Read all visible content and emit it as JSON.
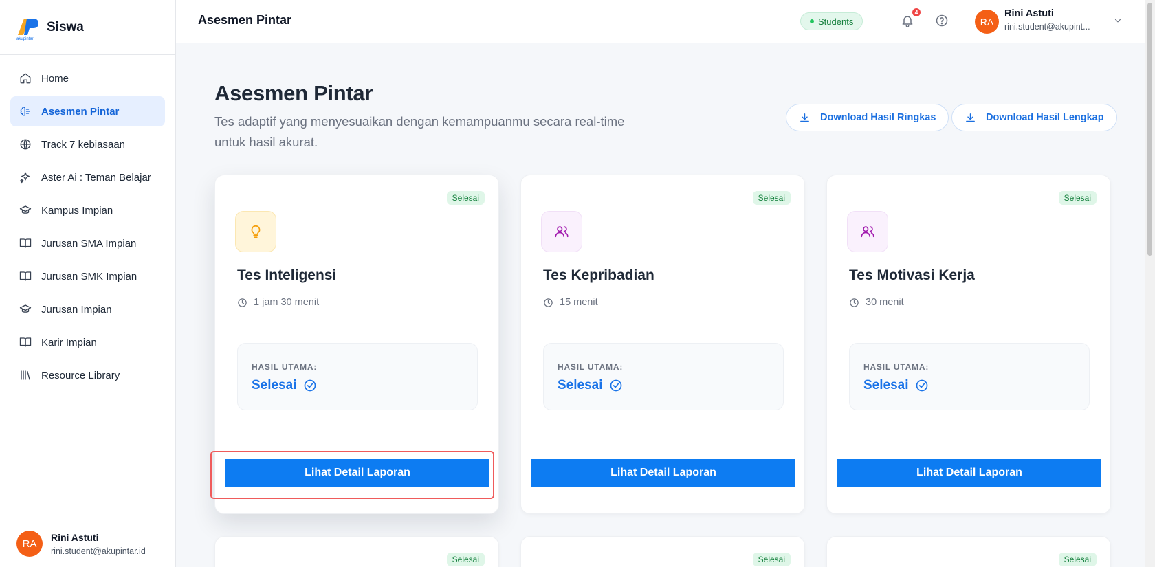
{
  "sidebar": {
    "brand": "Siswa",
    "logo_text": "akupintar",
    "items": [
      {
        "label": "Home",
        "icon": "home-icon"
      },
      {
        "label": "Asesmen Pintar",
        "icon": "brain-icon",
        "active": true
      },
      {
        "label": "Track 7 kebiasaan",
        "icon": "globe-icon"
      },
      {
        "label": "Aster Ai : Teman Belajar",
        "icon": "sparkles-icon"
      },
      {
        "label": "Kampus Impian",
        "icon": "graduation-cap-icon"
      },
      {
        "label": "Jurusan SMA Impian",
        "icon": "book-icon"
      },
      {
        "label": "Jurusan SMK Impian",
        "icon": "book-icon"
      },
      {
        "label": "Jurusan Impian",
        "icon": "graduation-cap-icon"
      },
      {
        "label": "Karir Impian",
        "icon": "book-icon"
      },
      {
        "label": "Resource Library",
        "icon": "library-icon"
      }
    ],
    "user": {
      "initials": "RA",
      "name": "Rini Astuti",
      "email": "rini.student@akupintar.id"
    }
  },
  "header": {
    "title": "Asesmen Pintar",
    "role": "Students",
    "notification_count": "4",
    "user": {
      "initials": "RA",
      "name": "Rini Astuti",
      "email": "rini.student@akupint..."
    }
  },
  "main": {
    "title": "Asesmen Pintar",
    "description": "Tes adaptif yang menyesuaikan dengan kemampuanmu secara real-time untuk hasil akurat.",
    "download_summary": "Download Hasil Ringkas",
    "download_full": "Download Hasil Lengkap",
    "cards": [
      {
        "status": "Selesai",
        "icon": "lightbulb-icon",
        "title": "Tes Inteligensi",
        "duration": "1 jam 30 menit",
        "result_label": "HASIL UTAMA:",
        "result_value": "Selesai",
        "button": "Lihat Detail Laporan"
      },
      {
        "status": "Selesai",
        "icon": "users-icon",
        "title": "Tes Kepribadian",
        "duration": "15 menit",
        "result_label": "HASIL UTAMA:",
        "result_value": "Selesai",
        "button": "Lihat Detail Laporan"
      },
      {
        "status": "Selesai",
        "icon": "users-icon",
        "title": "Tes Motivasi Kerja",
        "duration": "30 menit",
        "result_label": "HASIL UTAMA:",
        "result_value": "Selesai",
        "button": "Lihat Detail Laporan"
      }
    ],
    "next_row_status": [
      "Selesai",
      "Selesai",
      "Selesai"
    ]
  },
  "colors": {
    "primary": "#0d7cf2",
    "accent_text": "#1a73e8",
    "success": "#15803d",
    "avatar": "#f45f16",
    "highlight": "#ef5b5b"
  }
}
